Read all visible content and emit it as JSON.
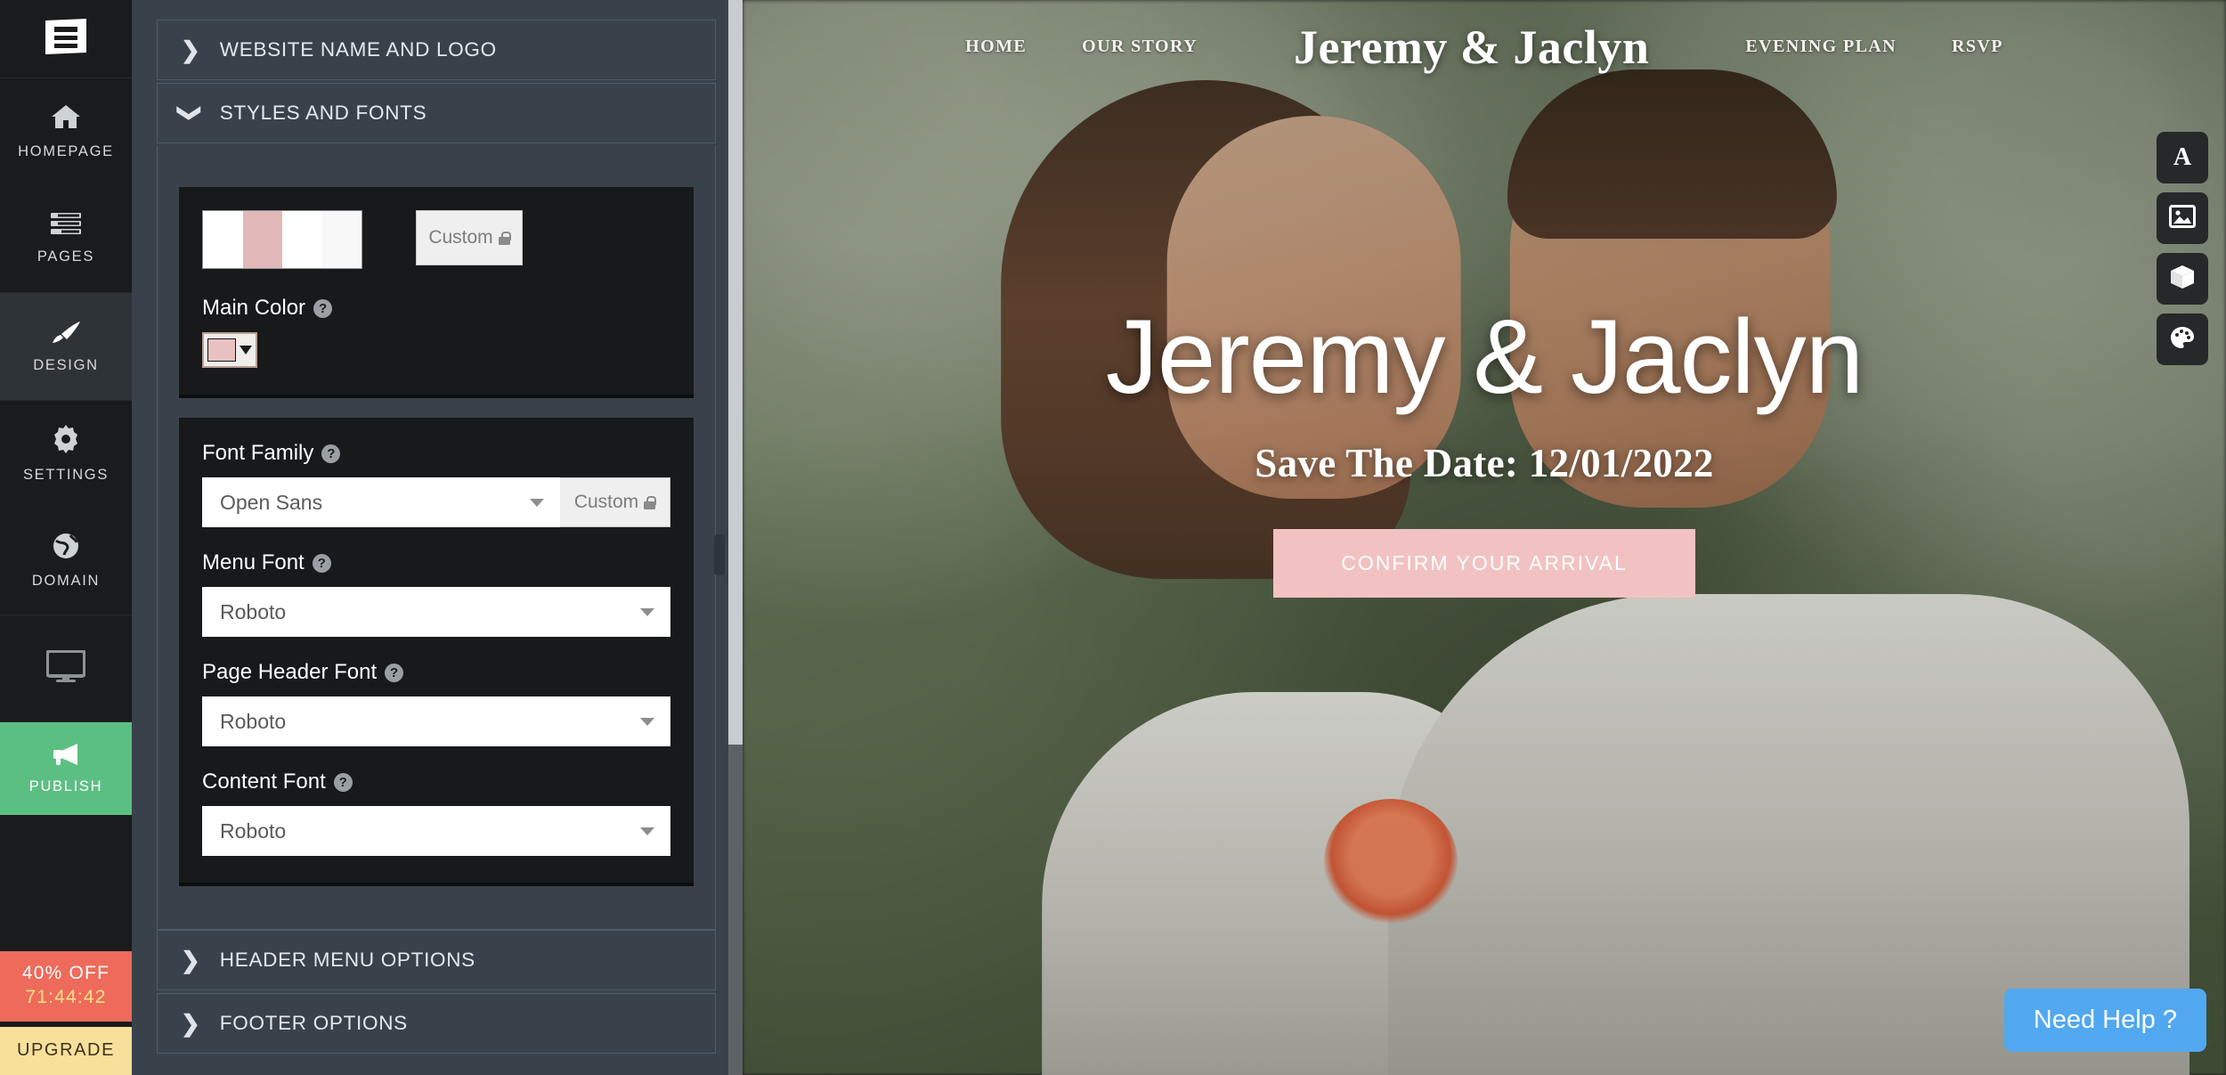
{
  "rail": {
    "logo_icon": "document-stack-icon",
    "items": [
      {
        "label": "HOMEPAGE",
        "icon": "home-icon",
        "active": false
      },
      {
        "label": "PAGES",
        "icon": "pages-icon",
        "active": false
      },
      {
        "label": "DESIGN",
        "icon": "paintbrush-icon",
        "active": true
      },
      {
        "label": "SETTINGS",
        "icon": "gear-icon",
        "active": false
      },
      {
        "label": "DOMAIN",
        "icon": "globe-icon",
        "active": false
      }
    ],
    "preview_icon": "monitor-icon",
    "publish_label": "PUBLISH",
    "publish_icon": "megaphone-icon",
    "publish_color": "#5cbf82",
    "discount_label": "40% OFF",
    "discount_timer": "71:44:42",
    "discount_color": "#ee6a5a",
    "discount_timer_color": "#ffe08a",
    "upgrade_label": "UPGRADE",
    "upgrade_color": "#f9e09a"
  },
  "panel": {
    "sections": [
      {
        "title": "WEBSITE NAME AND LOGO",
        "expanded": false,
        "chevron": "chevron-right-icon"
      },
      {
        "title": "STYLES AND FONTS",
        "expanded": true,
        "chevron": "chevron-down-icon"
      },
      {
        "title": "HEADER MENU OPTIONS",
        "expanded": false,
        "chevron": "chevron-right-icon"
      },
      {
        "title": "FOOTER OPTIONS",
        "expanded": false,
        "chevron": "chevron-right-icon"
      }
    ],
    "styles": {
      "palette_swatches": [
        "#ffffff",
        "#e2b8b8",
        "#ffffff",
        "#f8f8f8"
      ],
      "custom_label": "Custom",
      "custom_icon": "lock-icon",
      "main_color_label": "Main Color",
      "main_color_value": "#e8c2c2",
      "help_icon": "help-icon"
    },
    "fonts": {
      "font_family_label": "Font Family",
      "font_family_value": "Open Sans",
      "font_family_custom": "Custom",
      "menu_font_label": "Menu Font",
      "menu_font_value": "Roboto",
      "page_header_font_label": "Page Header Font",
      "page_header_font_value": "Roboto",
      "content_font_label": "Content Font",
      "content_font_value": "Roboto"
    }
  },
  "preview": {
    "nav_left": [
      {
        "label": "HOME"
      },
      {
        "label": "OUR STORY"
      }
    ],
    "site_title": "Jeremy & Jaclyn",
    "nav_right": [
      {
        "label": "EVENING PLAN"
      },
      {
        "label": "RSVP"
      }
    ],
    "hero_title": "Jeremy & Jaclyn",
    "hero_subtitle": "Save The Date: 12/01/2022",
    "hero_cta": "CONFIRM YOUR ARRIVAL",
    "hero_cta_color": "#f2c2c2",
    "tools": [
      {
        "icon": "text-icon"
      },
      {
        "icon": "image-icon"
      },
      {
        "icon": "box-icon"
      },
      {
        "icon": "palette-icon"
      }
    ],
    "need_help_label": "Need Help ?",
    "need_help_color": "#51a8f0"
  }
}
